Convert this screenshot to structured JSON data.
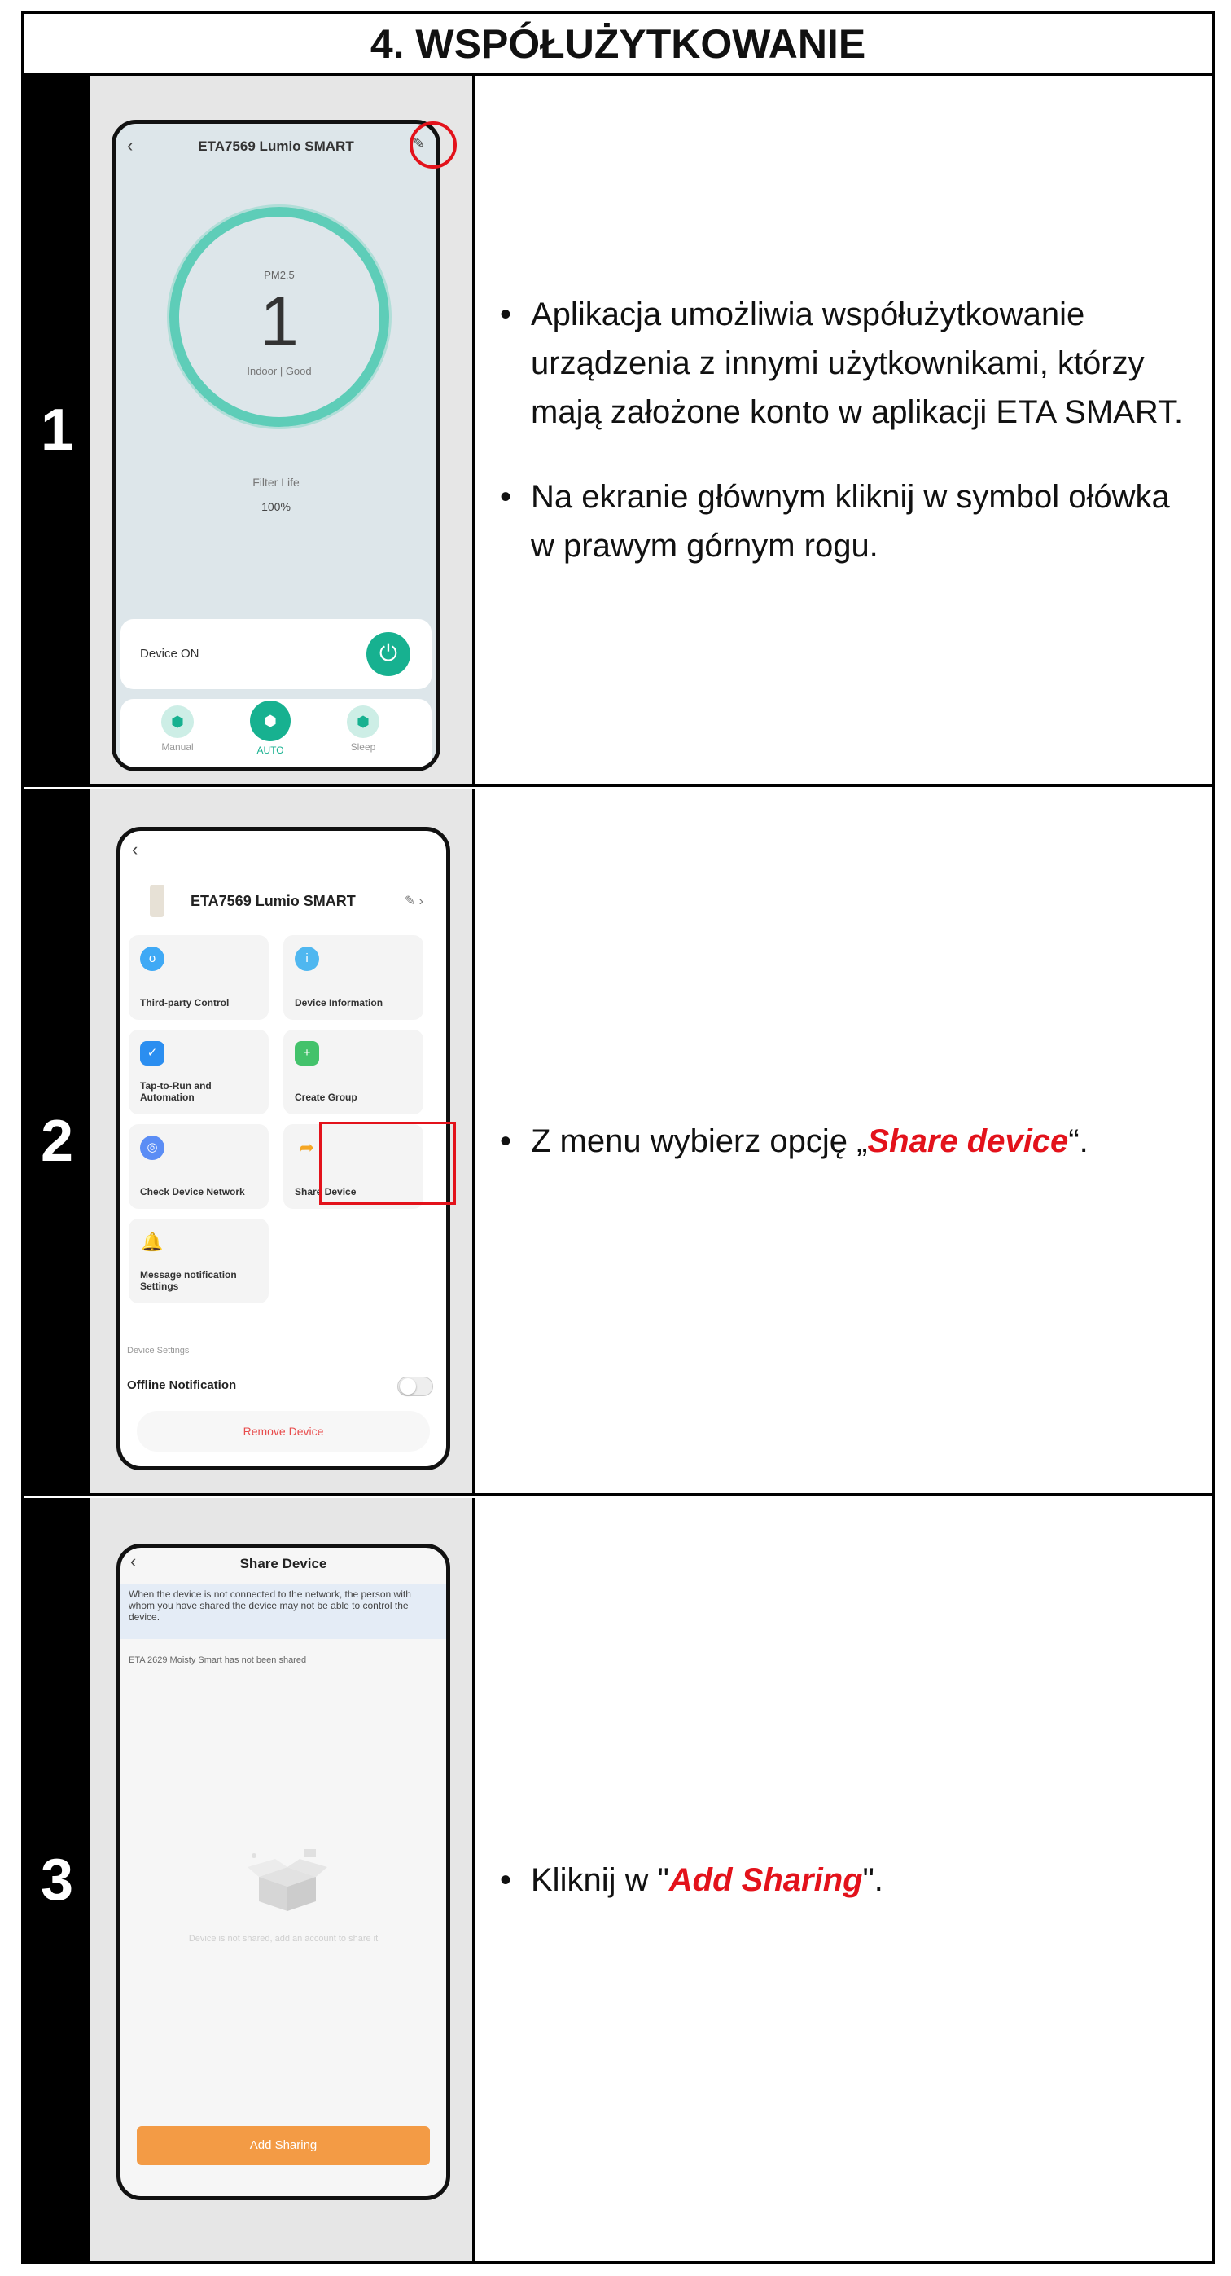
{
  "title": "4. WSPÓŁUŻYTKOWANIE",
  "steps": [
    {
      "number": "1",
      "bullets": [
        "Aplikacja umożliwia współużytkowanie urządzenia z innymi użytkownikami, którzy mają założone konto w aplikacji ETA SMART.",
        "Na ekranie głównym kliknij w symbol ołówka w prawym górnym rogu."
      ],
      "screen": {
        "title": "ETA7569 Lumio SMART",
        "pm_label": "PM2.5",
        "pm_value": "1",
        "air_status": "Indoor | Good",
        "filter_label": "Filter Life",
        "filter_value": "100%",
        "device_status": "Device ON",
        "modes": [
          "Manual",
          "AUTO",
          "Sleep"
        ],
        "active_mode": "AUTO"
      }
    },
    {
      "number": "2",
      "bullet_prefix": "Z menu wybierz opcję „",
      "bullet_em": "Share device",
      "bullet_suffix": "“.",
      "screen": {
        "device_name": "ETA7569 Lumio SMART",
        "tiles": [
          "Third-party Control",
          "Device Information",
          "Tap-to-Run and Automation",
          "Create Group",
          "Check Device Network",
          "Share Device",
          "Message notification Settings"
        ],
        "highlighted_tile": "Share Device",
        "section_label": "Device Settings",
        "offline_label": "Offline Notification",
        "remove_label": "Remove Device"
      }
    },
    {
      "number": "3",
      "bullet_prefix": "Kliknij w \"",
      "bullet_em": "Add Sharing",
      "bullet_suffix": "\".",
      "screen": {
        "title": "Share Device",
        "info_text": "When the device is not connected to the network, the person with whom you have shared the device may not be able to control the device.",
        "not_shared": "ETA 2629 Moisty Smart has not been shared",
        "empty_hint": "Device is not shared, add an account to share it",
        "button_label": "Add Sharing"
      }
    }
  ],
  "colors": {
    "accent_red": "#e3121b",
    "teal": "#17b190",
    "orange": "#f39b45"
  }
}
